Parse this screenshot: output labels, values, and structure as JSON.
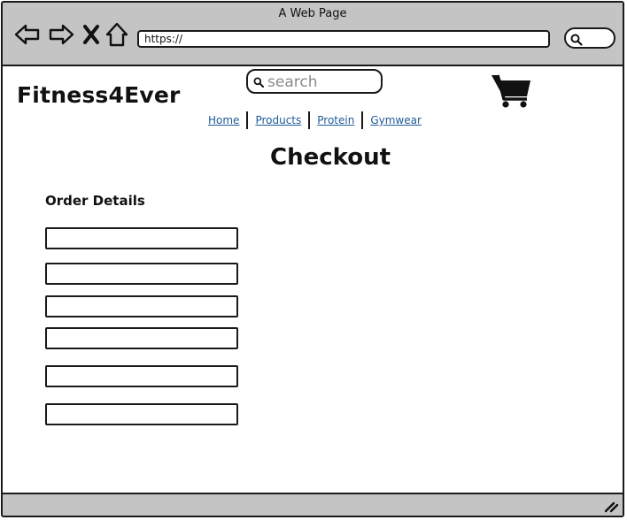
{
  "window": {
    "title": "A Web Page"
  },
  "browser": {
    "url": "https://",
    "icons": [
      "arrow-left-icon",
      "arrow-right-icon",
      "close-icon",
      "home-icon",
      "search-icon"
    ]
  },
  "site": {
    "brand": "Fitness4Ever",
    "search_placeholder": "search",
    "cart_icon": "shopping-cart-icon"
  },
  "nav": {
    "items": [
      {
        "label": "Home"
      },
      {
        "label": "Products"
      },
      {
        "label": "Protein"
      },
      {
        "label": "Gymwear"
      }
    ]
  },
  "page": {
    "title": "Checkout",
    "section_title": "Order Details"
  },
  "form": {
    "fields": [
      {
        "value": ""
      },
      {
        "value": ""
      },
      {
        "value": ""
      },
      {
        "value": ""
      },
      {
        "value": ""
      },
      {
        "value": ""
      }
    ]
  }
}
